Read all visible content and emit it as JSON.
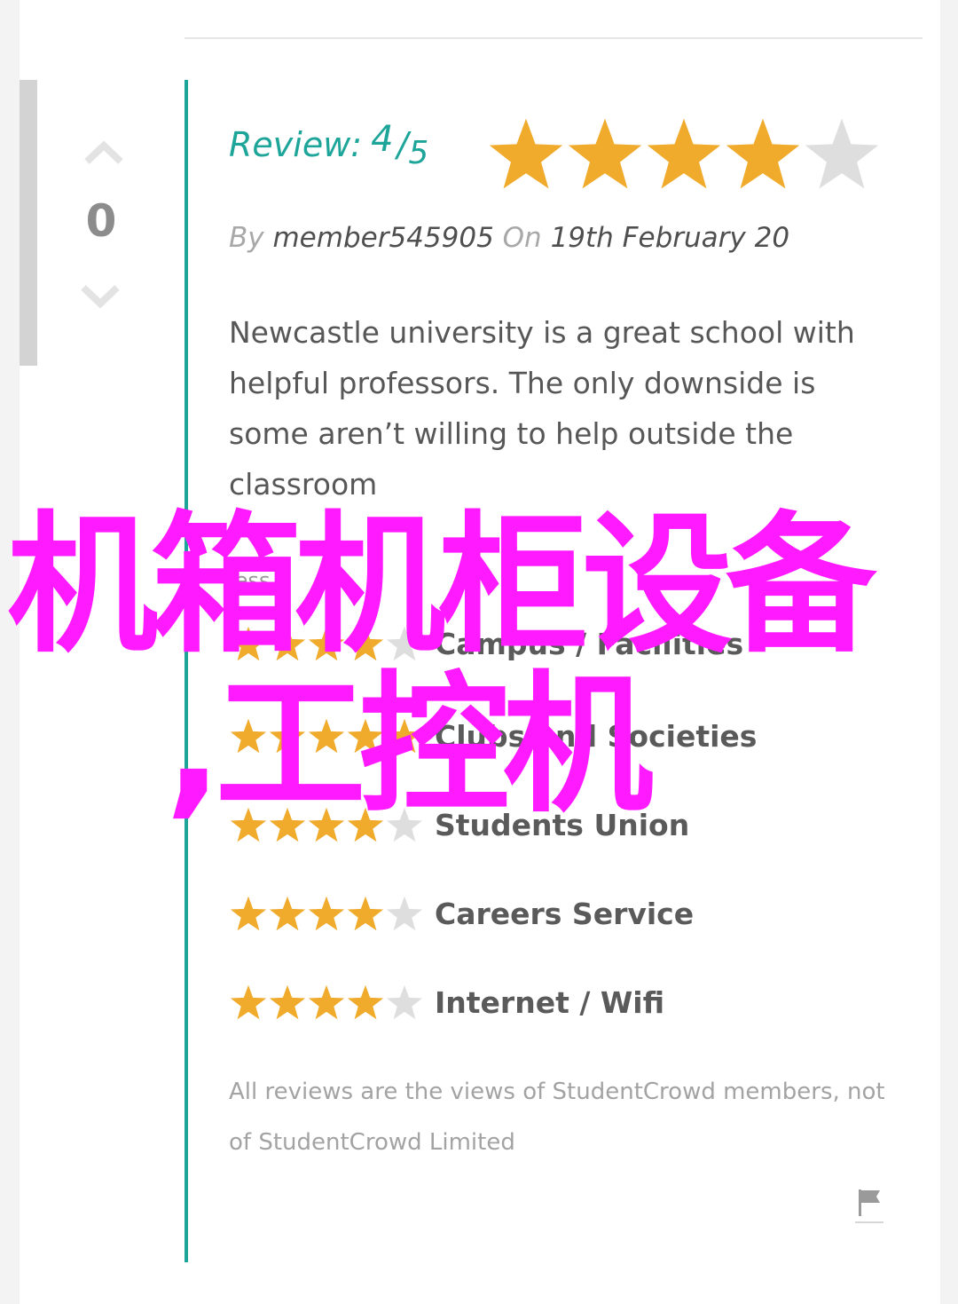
{
  "vote": {
    "count": "0"
  },
  "review": {
    "label": "Review:",
    "score": "4",
    "slash": "/",
    "total": "5",
    "rating": 4,
    "max_rating": 5
  },
  "byline": {
    "by": "By",
    "author": "member545905",
    "on": "On",
    "date": "19th February 20"
  },
  "body": "Newcastle university is a great school with helpful professors. The only downside is some aren’t willing to help outside the classroom",
  "less_link": "less...",
  "categories": [
    {
      "label": "Campus / Facilities",
      "rating": 4
    },
    {
      "label": "Clubs and Societies",
      "rating": 5
    },
    {
      "label": "Students Union",
      "rating": 4
    },
    {
      "label": "Careers Service",
      "rating": 4
    },
    {
      "label": "Internet / Wifi",
      "rating": 4
    }
  ],
  "disclaimer": "All reviews are the views of StudentCrowd members, not of StudentCrowd Limited",
  "overlay": {
    "line1": "机箱机柜设备",
    "line2": ",工控机"
  },
  "colors": {
    "accent": "#1ea59a",
    "star_filled": "#f0ab2c",
    "star_empty": "#dedede",
    "overlay": "#ff1aff"
  }
}
